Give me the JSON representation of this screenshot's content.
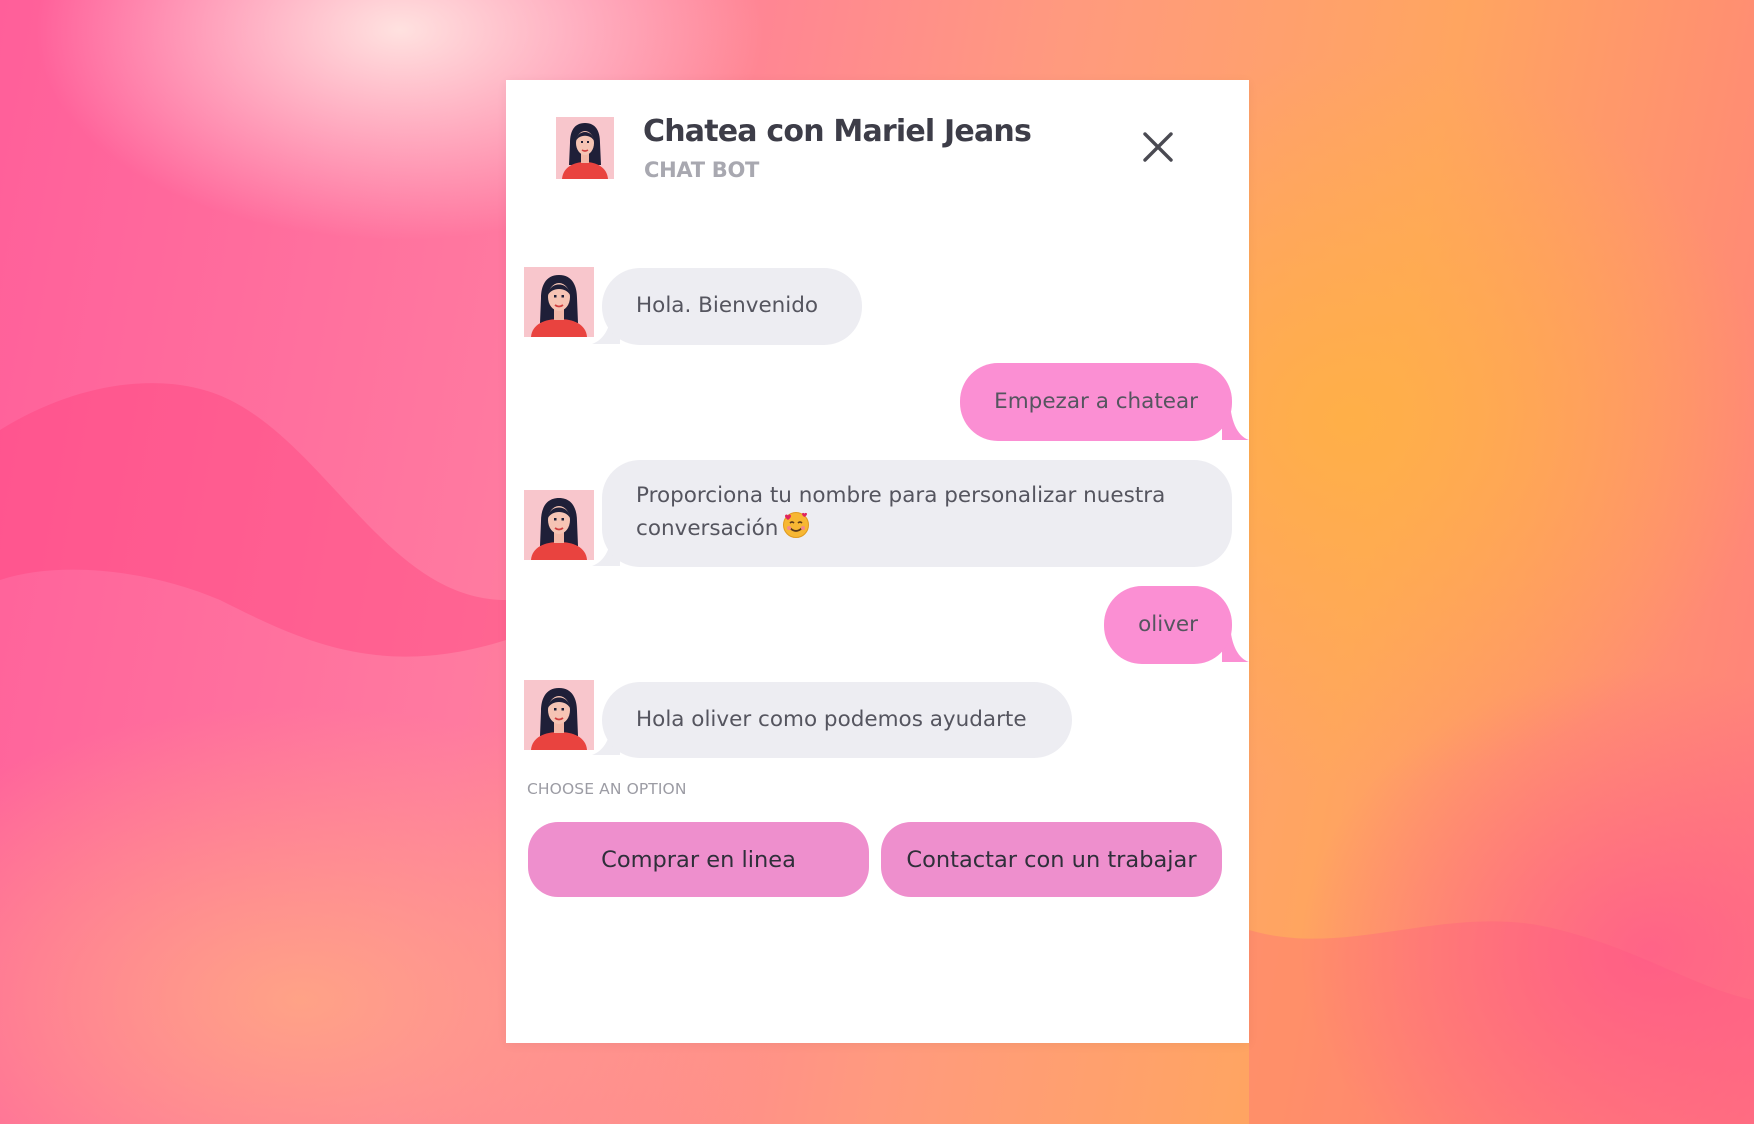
{
  "header": {
    "title": "Chatea con Mariel Jeans",
    "subtitle": "CHAT BOT",
    "avatar_icon": "woman-avatar-icon",
    "close_icon": "close-icon"
  },
  "messages": [
    {
      "sender": "bot",
      "text": "Hola. Bienvenido"
    },
    {
      "sender": "user",
      "text": "Empezar a chatear"
    },
    {
      "sender": "bot",
      "lines": [
        "Proporciona tu nombre para personalizar nuestra",
        "conversación"
      ],
      "emoji": "smiling-face-with-hearts-icon"
    },
    {
      "sender": "user",
      "text": "oliver"
    },
    {
      "sender": "bot",
      "text": "Hola oliver como podemos ayudarte"
    }
  ],
  "options": {
    "label": "CHOOSE AN OPTION",
    "buttons": [
      "Comprar en linea",
      "Contactar con un trabajar"
    ]
  },
  "colors": {
    "bot_bubble": "#ededf2",
    "user_bubble": "#fb8fd3",
    "option_button": "#ee8fcd",
    "title_text": "#3d3d48"
  }
}
